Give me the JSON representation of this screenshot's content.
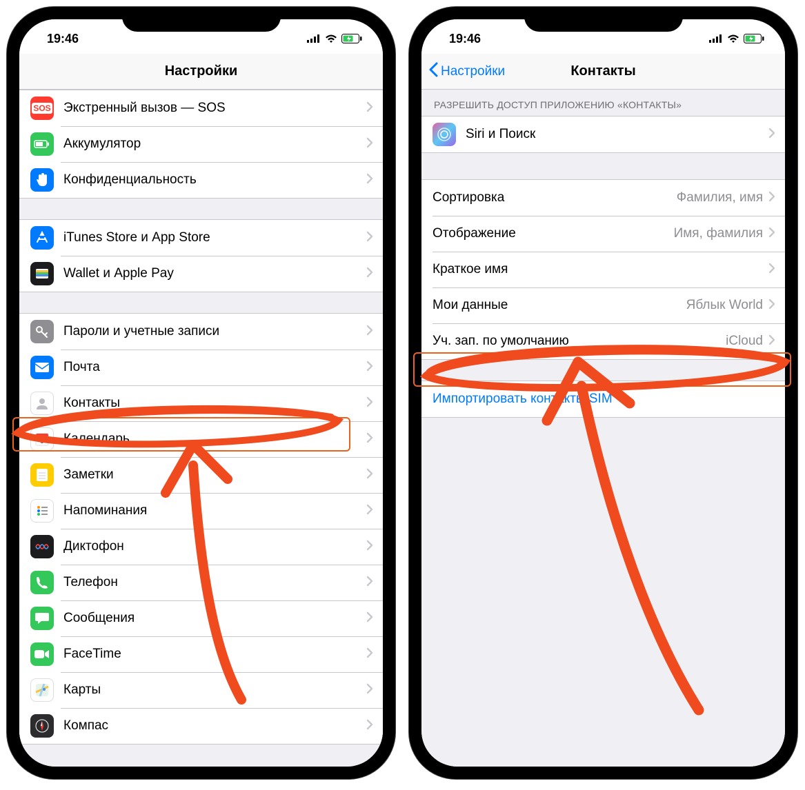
{
  "status_bar": {
    "time": "19:46"
  },
  "left": {
    "title": "Настройки",
    "groups": [
      {
        "items": [
          {
            "icon": "sos-icon",
            "bg": "bg-red",
            "label": "Экстренный вызов — SOS"
          },
          {
            "icon": "battery-icon",
            "bg": "bg-green",
            "label": "Аккумулятор"
          },
          {
            "icon": "hand-icon",
            "bg": "bg-blue",
            "label": "Конфиденциальность"
          }
        ]
      },
      {
        "items": [
          {
            "icon": "appstore-icon",
            "bg": "bg-blue",
            "label": "iTunes Store и App Store"
          },
          {
            "icon": "wallet-icon",
            "bg": "bg-black",
            "label": "Wallet и Apple Pay"
          }
        ]
      },
      {
        "items": [
          {
            "icon": "key-icon",
            "bg": "bg-gray",
            "label": "Пароли и учетные записи"
          },
          {
            "icon": "mail-icon",
            "bg": "bg-blue",
            "label": "Почта"
          },
          {
            "icon": "contacts-icon",
            "bg": "bg-white",
            "label": "Контакты",
            "highlight": true
          },
          {
            "icon": "calendar-icon",
            "bg": "bg-white",
            "label": "Календарь"
          },
          {
            "icon": "notes-icon",
            "bg": "bg-yellow",
            "label": "Заметки"
          },
          {
            "icon": "reminders-icon",
            "bg": "bg-white",
            "label": "Напоминания"
          },
          {
            "icon": "voice-icon",
            "bg": "bg-black",
            "label": "Диктофон"
          },
          {
            "icon": "phone-icon",
            "bg": "bg-green",
            "label": "Телефон"
          },
          {
            "icon": "messages-icon",
            "bg": "bg-green",
            "label": "Сообщения"
          },
          {
            "icon": "facetime-icon",
            "bg": "bg-green",
            "label": "FaceTime"
          },
          {
            "icon": "maps-icon",
            "bg": "bg-white",
            "label": "Карты"
          },
          {
            "icon": "compass-icon",
            "bg": "bg-dark",
            "label": "Компас"
          }
        ]
      }
    ]
  },
  "right": {
    "back": "Настройки",
    "title": "Контакты",
    "section_header": "РАЗРЕШИТЬ ДОСТУП ПРИЛОЖЕНИЮ «КОНТАКТЫ»",
    "siri": {
      "icon": "siri-icon",
      "bg": "bg-siri",
      "label": "Siri и Поиск"
    },
    "options": [
      {
        "label": "Сортировка",
        "value": "Фамилия, имя"
      },
      {
        "label": "Отображение",
        "value": "Имя, фамилия"
      },
      {
        "label": "Краткое имя",
        "value": ""
      },
      {
        "label": "Мои данные",
        "value": "Яблык World"
      },
      {
        "label": "Уч. зап. по умолчанию",
        "value": "iCloud",
        "highlight": true
      }
    ],
    "import_label": "Импортировать контакты SIM"
  }
}
